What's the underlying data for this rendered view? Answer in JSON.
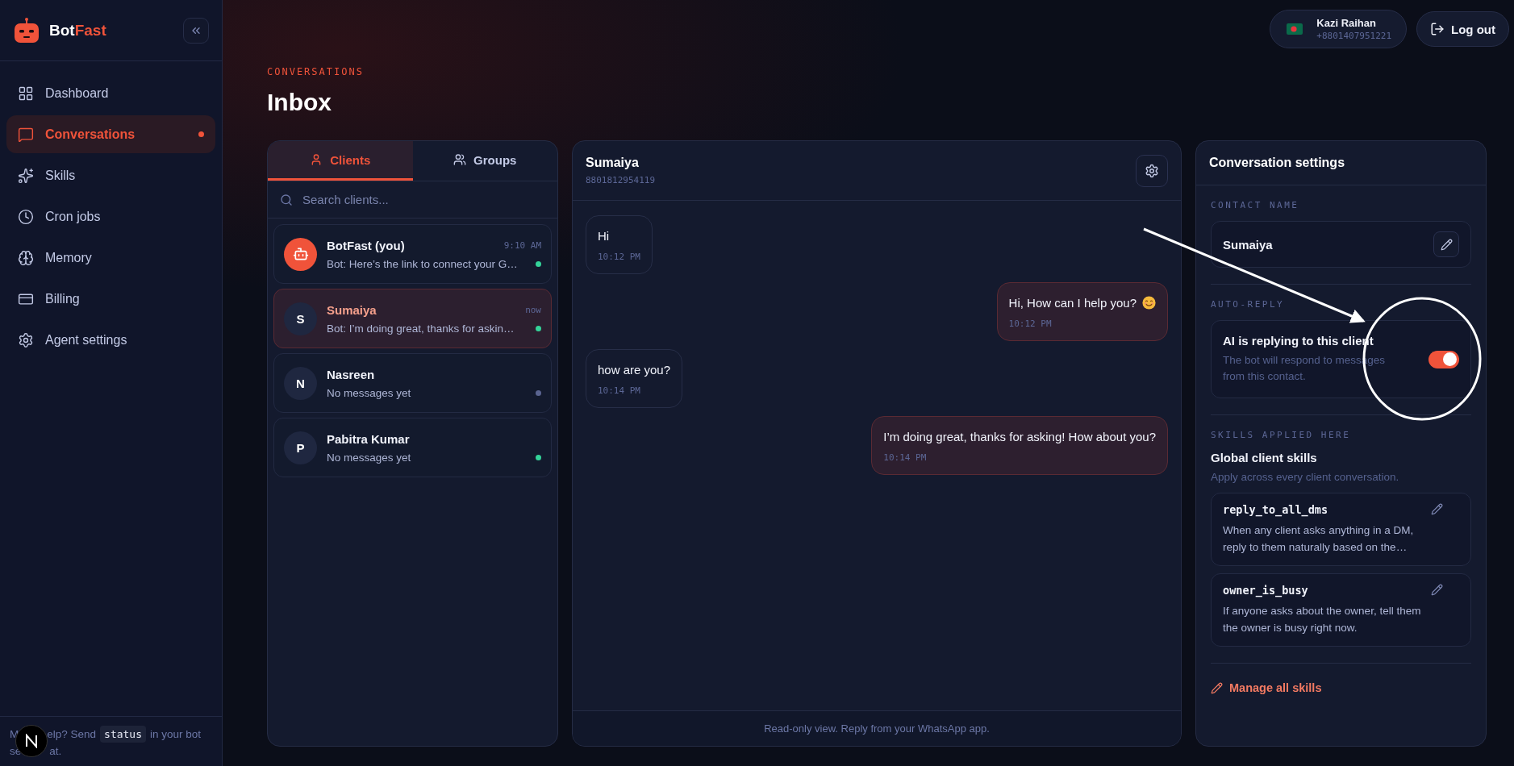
{
  "brand": {
    "name_start": "Bot",
    "name_end": "Fast"
  },
  "sidebar": {
    "items": [
      {
        "label": "Dashboard",
        "selected": false,
        "unread": false
      },
      {
        "label": "Conversations",
        "selected": true,
        "unread": true
      },
      {
        "label": "Skills",
        "selected": false,
        "unread": false
      },
      {
        "label": "Cron jobs",
        "selected": false,
        "unread": false
      },
      {
        "label": "Memory",
        "selected": false,
        "unread": false
      },
      {
        "label": "Billing",
        "selected": false,
        "unread": false
      },
      {
        "label": "Agent settings",
        "selected": false,
        "unread": false
      }
    ],
    "footer": {
      "line_1": [
        "M",
        "elp? Send"
      ],
      "code": "status",
      "line_1_end": "in your bot",
      "line_2": [
        "se",
        "at."
      ]
    }
  },
  "user": {
    "name": "Kazi Raihan",
    "phone": "+8801407951221"
  },
  "logout": "Log out",
  "page": {
    "eyebrow": "CONVERSATIONS",
    "title": "Inbox"
  },
  "tabs": [
    {
      "label": "Clients",
      "selected": true
    },
    {
      "label": "Groups",
      "selected": false
    }
  ],
  "search": {
    "placeholder": "Search clients..."
  },
  "clients": [
    {
      "kind": "bot",
      "name": "BotFast (you)",
      "time": "9:10 AM",
      "preview": "Bot: Here’s the link to connect your G…",
      "color": "#34d399",
      "selected": false
    },
    {
      "kind": "person",
      "initial": "S",
      "name": "Sumaiya",
      "time": "now",
      "preview": "Bot: I’m doing great, thanks for askin…",
      "color": "#34d399",
      "selected": true
    },
    {
      "kind": "person",
      "initial": "N",
      "name": "Nasreen",
      "preview": "No messages yet",
      "color": "#5a6490",
      "selected": false
    },
    {
      "kind": "person",
      "initial": "P",
      "name": "Pabitra Kumar",
      "preview": "No messages yet",
      "color": "#34d399",
      "selected": false
    }
  ],
  "chat": {
    "name": "Sumaiya",
    "phone": "8801812954119",
    "messages": [
      {
        "kind": "incoming",
        "text": "Hi",
        "time": "10:12 PM",
        "emoji": false
      },
      {
        "kind": "outgoing",
        "text": "Hi, How can I help you?",
        "time": "10:12 PM",
        "emoji": true
      },
      {
        "kind": "incoming",
        "text": "how are you?",
        "time": "10:14 PM",
        "emoji": false
      },
      {
        "kind": "outgoing",
        "text": "I’m doing great, thanks for asking! How about you?",
        "time": "10:14 PM",
        "emoji": false
      }
    ],
    "footer": "Read-only view. Reply from your WhatsApp app."
  },
  "settings": {
    "title": "Conversation settings",
    "contact_label": "CONTACT NAME",
    "contact_name": "Sumaiya",
    "auto_label": "AUTO-REPLY",
    "auto_title": "AI is replying to this client",
    "auto_desc": "The bot will respond to messages from this contact.",
    "auto_on": true,
    "skills_label": "SKILLS APPLIED HERE",
    "group_title": "Global client skills",
    "group_desc": "Apply across every client conversation.",
    "skills": [
      {
        "name": "reply_to_all_dms",
        "desc": "When any client asks anything in a DM, reply to them naturally based on the…"
      },
      {
        "name": "owner_is_busy",
        "desc": "If anyone asks about the owner, tell them the owner is busy right now."
      }
    ],
    "manage": "Manage all skills"
  }
}
